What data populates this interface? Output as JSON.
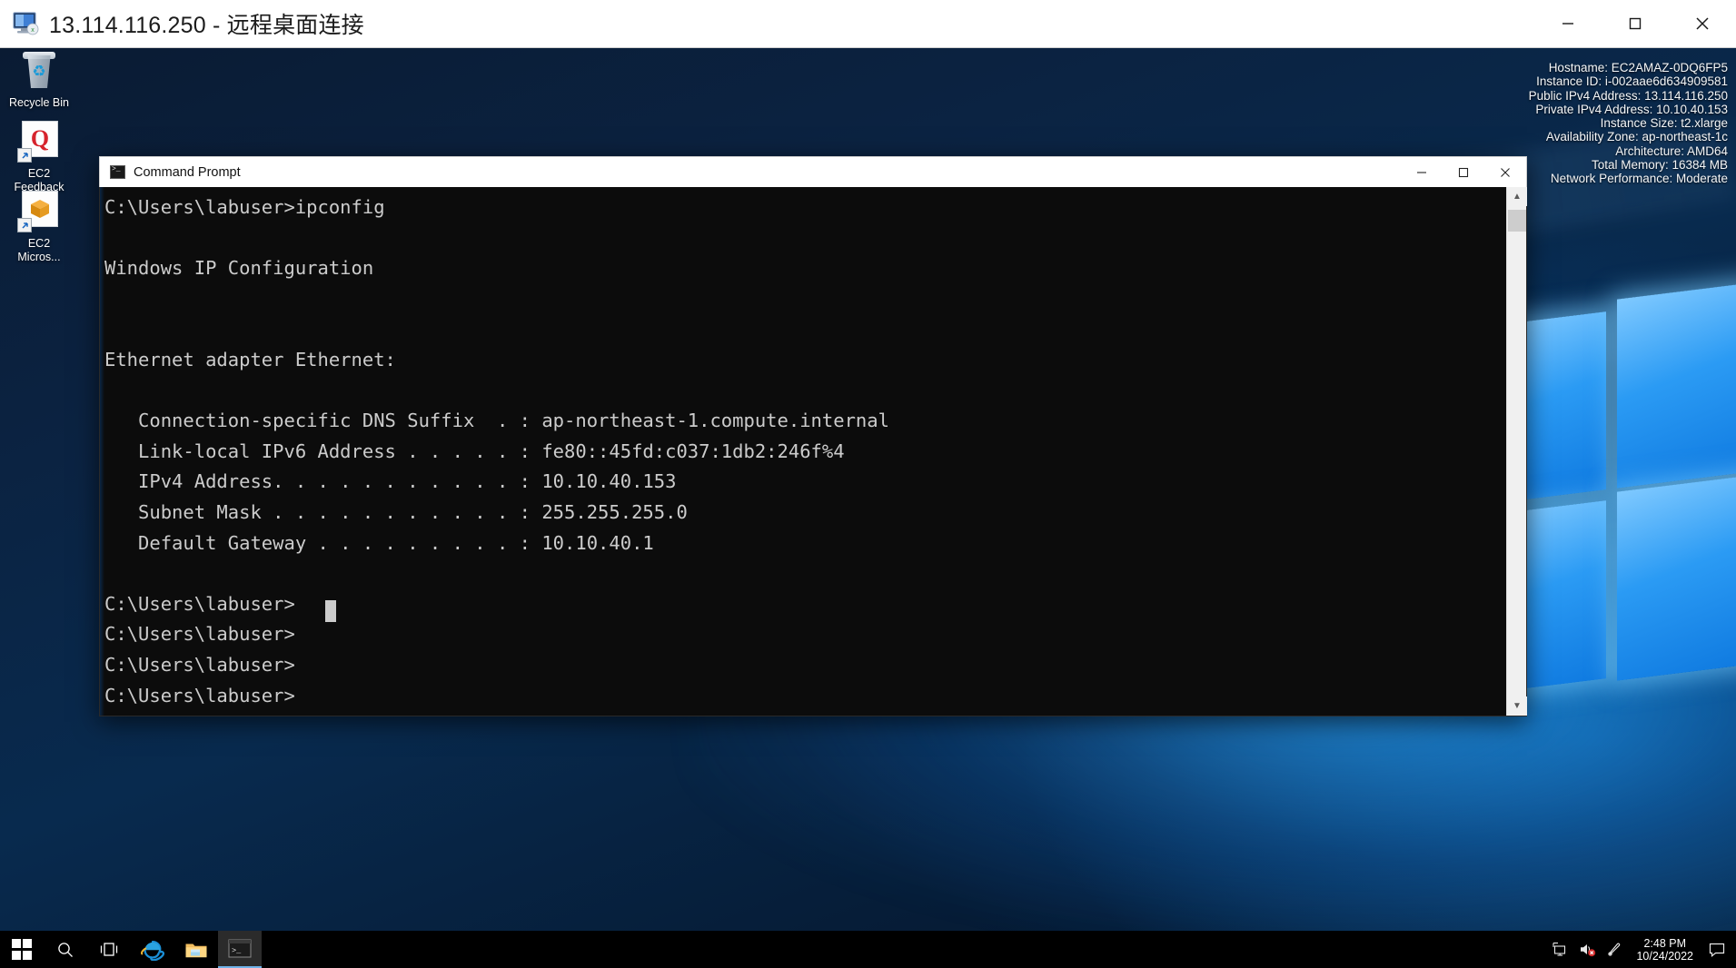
{
  "rdp_window": {
    "title": "13.114.116.250 - 远程桌面连接",
    "icon": "remote-desktop-icon",
    "controls": {
      "minimize": "minimize-icon",
      "maximize": "maximize-icon",
      "close": "close-icon"
    }
  },
  "desktop": {
    "icons": [
      {
        "name": "recycle-bin",
        "label": "Recycle Bin",
        "glyph": "recycle-bin-icon"
      },
      {
        "name": "ec2-feedback",
        "label": "EC2\nFeedback",
        "label_line1": "EC2",
        "label_line2": "Feedback",
        "glyph": "ec2-feedback-icon"
      },
      {
        "name": "ec2-microsoft",
        "label": "EC2\nMicros...",
        "label_line1": "EC2",
        "label_line2": "Micros...",
        "glyph": "ec2-microservices-icon"
      }
    ]
  },
  "ec2_info": {
    "lines": [
      "Hostname: EC2AMAZ-0DQ6FP5",
      "Instance ID: i-002aae6d634909581",
      "Public IPv4 Address: 13.114.116.250",
      "Private IPv4 Address: 10.10.40.153",
      "Instance Size: t2.xlarge",
      "Availability Zone: ap-northeast-1c",
      "Architecture: AMD64",
      "Total Memory: 16384 MB",
      "Network Performance: Moderate"
    ],
    "hostname": "EC2AMAZ-0DQ6FP5",
    "instance_id": "i-002aae6d634909581",
    "public_ipv4": "13.114.116.250",
    "private_ipv4": "10.10.40.153",
    "instance_size": "t2.xlarge",
    "availability_zone": "ap-northeast-1c",
    "architecture": "AMD64",
    "total_memory": "16384 MB",
    "network_performance": "Moderate"
  },
  "cmd_window": {
    "title": "Command Prompt",
    "icon": "command-prompt-icon",
    "controls": {
      "minimize": "minimize-icon",
      "maximize": "maximize-icon",
      "close": "close-icon"
    },
    "console_text": "C:\\Users\\labuser>ipconfig\n\nWindows IP Configuration\n\n\nEthernet adapter Ethernet:\n\n   Connection-specific DNS Suffix  . : ap-northeast-1.compute.internal\n   Link-local IPv6 Address . . . . . : fe80::45fd:c037:1db2:246f%4\n   IPv4 Address. . . . . . . . . . . : 10.10.40.153\n   Subnet Mask . . . . . . . . . . . : 255.255.255.0\n   Default Gateway . . . . . . . . . : 10.10.40.1\n\nC:\\Users\\labuser>\nC:\\Users\\labuser>\nC:\\Users\\labuser>\nC:\\Users\\labuser>",
    "command": "ipconfig",
    "prompt": "C:\\Users\\labuser>",
    "ipconfig": {
      "heading": "Windows IP Configuration",
      "adapter": "Ethernet adapter Ethernet:",
      "dns_suffix": "ap-northeast-1.compute.internal",
      "link_local_ipv6": "fe80::45fd:c037:1db2:246f%4",
      "ipv4_address": "10.10.40.153",
      "subnet_mask": "255.255.255.0",
      "default_gateway": "10.10.40.1"
    },
    "scrollbar": {
      "up": "chevron-up-icon",
      "down": "chevron-down-icon"
    }
  },
  "taskbar": {
    "buttons": [
      {
        "name": "start-button",
        "icon": "windows-logo-icon"
      },
      {
        "name": "search-button",
        "icon": "search-icon"
      },
      {
        "name": "task-view-button",
        "icon": "task-view-icon"
      },
      {
        "name": "internet-explorer-button",
        "icon": "internet-explorer-icon"
      },
      {
        "name": "file-explorer-button",
        "icon": "folder-icon"
      },
      {
        "name": "command-prompt-taskbar-button",
        "icon": "command-prompt-icon"
      }
    ],
    "tray": [
      {
        "name": "network-tray-icon",
        "icon": "monitor-network-icon"
      },
      {
        "name": "volume-tray-icon",
        "icon": "speaker-muted-icon"
      },
      {
        "name": "pen-tray-icon",
        "icon": "pen-icon"
      }
    ],
    "clock": {
      "time": "2:48 PM",
      "date": "10/24/2022"
    },
    "notifications": {
      "icon": "notification-icon"
    }
  },
  "colors": {
    "accent": "#0078d7",
    "taskbar_bg": "#000000",
    "console_bg": "#0c0c0c",
    "console_fg": "#cccccc",
    "titlebar_bg": "#ffffff"
  }
}
